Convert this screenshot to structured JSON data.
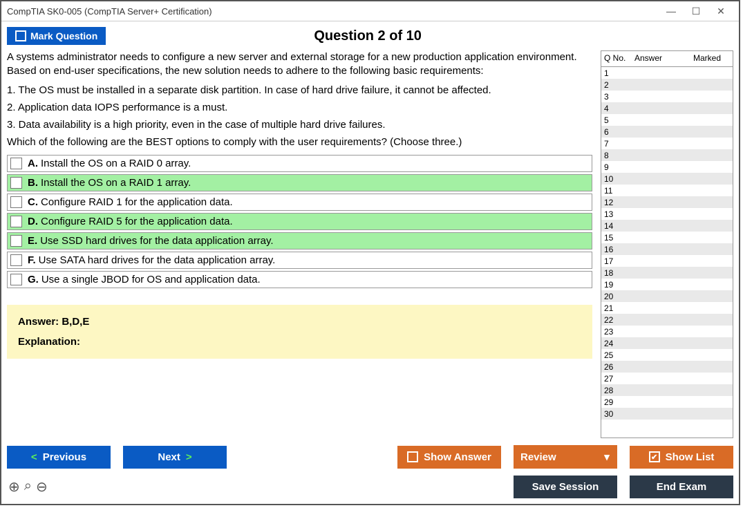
{
  "window": {
    "title": "CompTIA SK0-005 (CompTIA Server+ Certification)"
  },
  "mark_label": "Mark Question",
  "question_heading": "Question 2 of 10",
  "question_intro": "A systems administrator needs to configure a new server and external storage for a new production application environment. Based on end-user specifications, the new solution needs to adhere to the following basic requirements:",
  "req1": "1. The OS must be installed in a separate disk partition. In case of hard drive failure, it cannot be affected.",
  "req2": "2. Application data IOPS performance is a must.",
  "req3": "3. Data availability is a high priority, even in the case of multiple hard drive failures.",
  "question_tail": "Which of the following are the BEST options to comply with the user requirements? (Choose three.)",
  "options": [
    {
      "letter": "A.",
      "text": "Install the OS on a RAID 0 array.",
      "hl": false
    },
    {
      "letter": "B.",
      "text": "Install the OS on a RAID 1 array.",
      "hl": true
    },
    {
      "letter": "C.",
      "text": "Configure RAID 1 for the application data.",
      "hl": false
    },
    {
      "letter": "D.",
      "text": "Configure RAID 5 for the application data.",
      "hl": true
    },
    {
      "letter": "E.",
      "text": "Use SSD hard drives for the data application array.",
      "hl": true
    },
    {
      "letter": "F.",
      "text": "Use SATA hard drives for the data application array.",
      "hl": false
    },
    {
      "letter": "G.",
      "text": "Use a single JBOD for OS and application data.",
      "hl": false
    }
  ],
  "answer_label": "Answer: B,D,E",
  "explanation_label": "Explanation:",
  "side": {
    "qno": "Q No.",
    "answer": "Answer",
    "marked": "Marked",
    "rows": 30
  },
  "buttons": {
    "previous": "Previous",
    "next": "Next",
    "show_answer": "Show Answer",
    "review": "Review",
    "show_list": "Show List",
    "save_session": "Save Session",
    "end_exam": "End Exam"
  },
  "glyphs": {
    "left": "<",
    "right": ">",
    "check": "✔",
    "min": "—",
    "max": "☐",
    "close": "✕",
    "dd": "▾",
    "zin": "⊕",
    "zsrch": "⌕",
    "zout": "⊖"
  }
}
